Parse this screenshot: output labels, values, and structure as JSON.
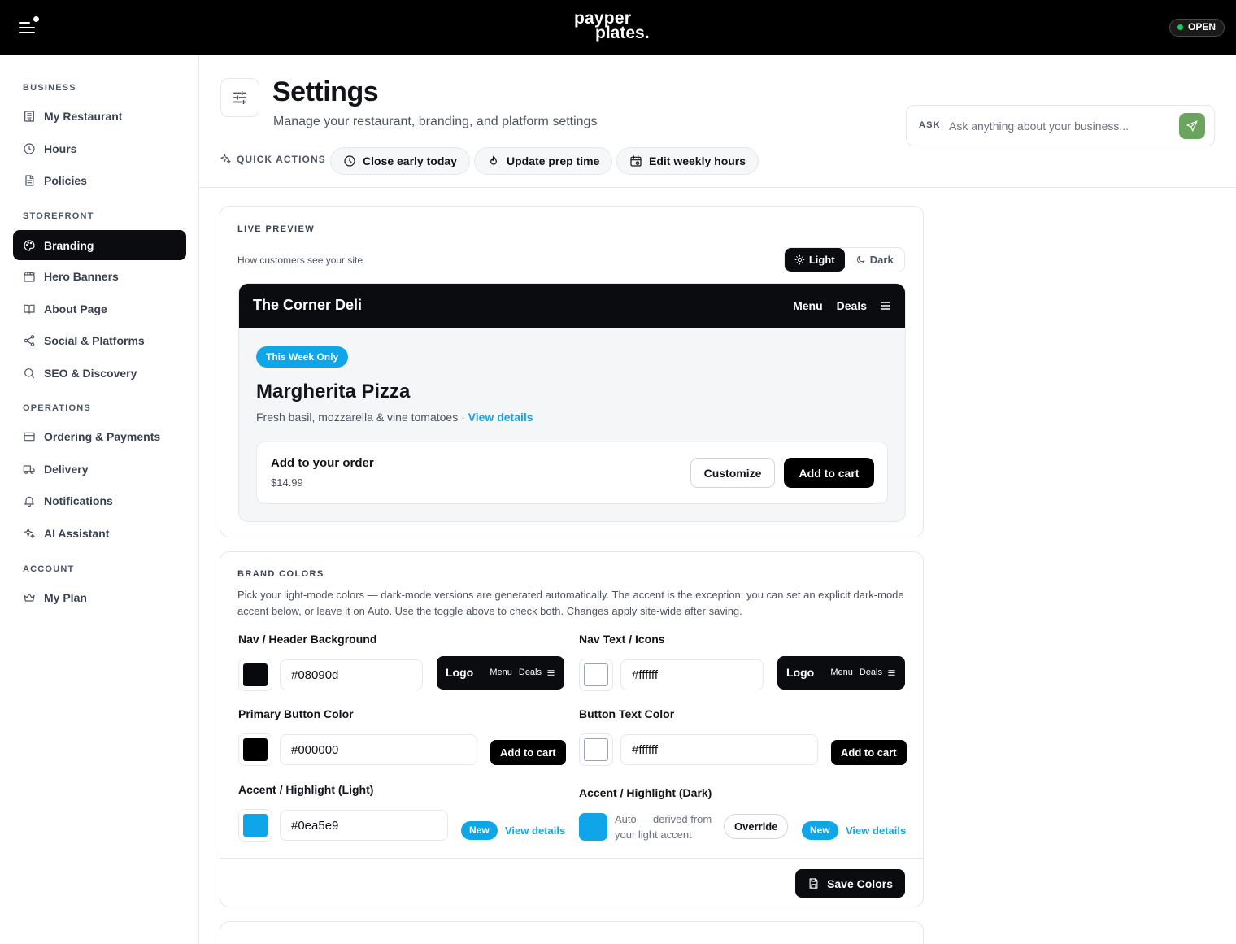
{
  "topbar": {
    "logo_line1": "payper",
    "logo_line2": "plates.",
    "status": "OPEN",
    "status_color": "#22c55e"
  },
  "sidebar": {
    "sections": [
      {
        "label": "BUSINESS"
      },
      {
        "label": "STOREFRONT"
      },
      {
        "label": "OPERATIONS"
      },
      {
        "label": "ACCOUNT"
      }
    ],
    "items": [
      {
        "label": "My Restaurant",
        "icon": "building-icon"
      },
      {
        "label": "Hours",
        "icon": "clock-icon"
      },
      {
        "label": "Policies",
        "icon": "document-icon"
      },
      {
        "label": "Branding",
        "icon": "palette-icon",
        "active": true
      },
      {
        "label": "Hero Banners",
        "icon": "clapperboard-icon"
      },
      {
        "label": "About Page",
        "icon": "book-icon"
      },
      {
        "label": "Social & Platforms",
        "icon": "share-icon"
      },
      {
        "label": "SEO & Discovery",
        "icon": "search-icon"
      },
      {
        "label": "Ordering & Payments",
        "icon": "card-icon"
      },
      {
        "label": "Delivery",
        "icon": "truck-icon"
      },
      {
        "label": "Notifications",
        "icon": "bell-icon"
      },
      {
        "label": "AI Assistant",
        "icon": "sparkles-icon"
      },
      {
        "label": "My Plan",
        "icon": "crown-icon"
      }
    ]
  },
  "header": {
    "title": "Settings",
    "subtitle": "Manage your restaurant, branding, and platform settings",
    "quick_actions_label": "QUICK ACTIONS",
    "quick_actions": [
      {
        "label": "Close early today",
        "icon": "clock-icon"
      },
      {
        "label": "Update prep time",
        "icon": "flame-icon"
      },
      {
        "label": "Edit weekly hours",
        "icon": "calendar-icon"
      }
    ],
    "ask": {
      "label": "ASK",
      "placeholder": "Ask anything about your business...",
      "send_color": "#6aa45e"
    }
  },
  "live_preview": {
    "title": "LIVE PREVIEW",
    "subtitle": "How customers see your site",
    "toggle": {
      "light": "Light",
      "dark": "Dark",
      "selected": "Light"
    },
    "site": {
      "brand": "The Corner Deli",
      "nav_links": [
        "Menu",
        "Deals"
      ],
      "pill": "This Week Only",
      "item_name": "Margherita Pizza",
      "item_desc": "Fresh basil, mozzarella & vine tomatoes ·",
      "view_details": "View details",
      "order_title": "Add to your order",
      "order_price": "$14.99",
      "customize": "Customize",
      "add_to_cart": "Add to cart"
    }
  },
  "brand_colors": {
    "title": "BRAND COLORS",
    "description": "Pick your light-mode colors — dark-mode versions are generated automatically. The accent is the exception: you can set an explicit dark-mode accent below, or leave it on Auto. Use the toggle above to check both. Changes apply site-wide after saving.",
    "nav_bg": {
      "label": "Nav / Header Background",
      "value": "#08090d"
    },
    "nav_text": {
      "label": "Nav Text / Icons",
      "value": "#ffffff"
    },
    "primary_button": {
      "label": "Primary Button Color",
      "value": "#000000"
    },
    "button_text": {
      "label": "Button Text Color",
      "value": "#ffffff"
    },
    "accent_light": {
      "label": "Accent / Highlight (Light)",
      "value": "#0ea5e9"
    },
    "accent_dark": {
      "label": "Accent / Highlight (Dark)",
      "auto_text": "Auto — derived from your light accent",
      "override": "Override"
    },
    "mini_nav": {
      "logo": "Logo",
      "links": [
        "Menu",
        "Deals"
      ]
    },
    "mini_cart": "Add to cart",
    "new_pill": "New",
    "view_details": "View details",
    "save": "Save Colors"
  }
}
